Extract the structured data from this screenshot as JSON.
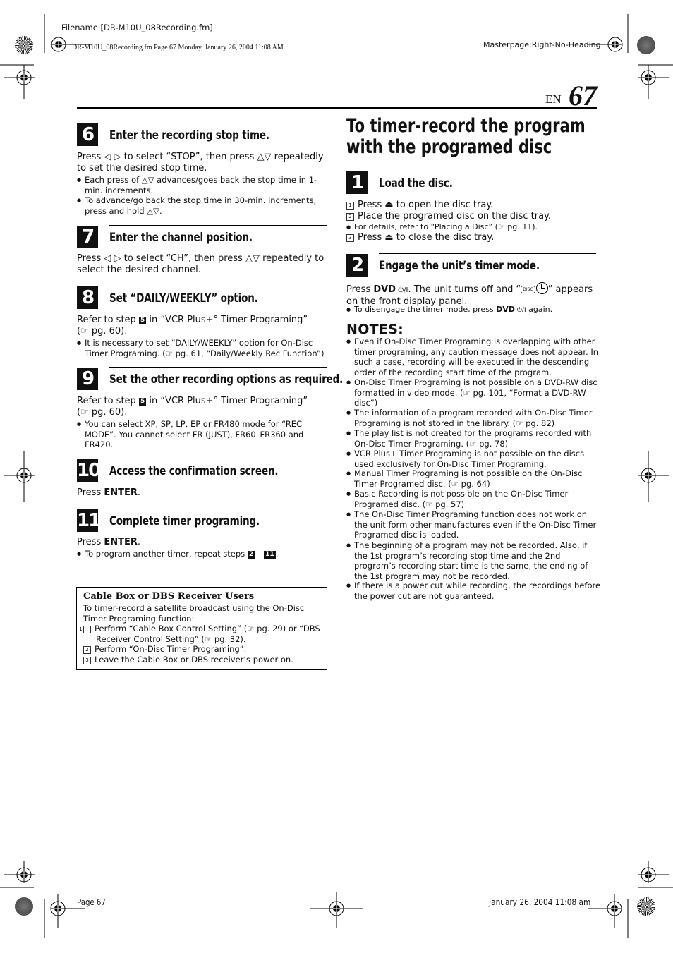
{
  "print_header": {
    "filename": "Filename [DR-M10U_08Recording.fm]",
    "file_line": "DR-M10U_08Recording.fm  Page 67  Monday, January 26, 2004  11:08 AM",
    "masterpage": "Masterpage:Right-No-Heading"
  },
  "page_header": {
    "lang": "EN",
    "page_number": "67"
  },
  "left_column": {
    "steps": [
      {
        "number": "6",
        "title": "Enter the recording stop time.",
        "body": "Press ◁ ▷ to select “STOP”, then press △▽ repeatedly to set the desired stop time.",
        "bullets": [
          "Each press of △▽ advances/goes back the stop time in 1-min. increments.",
          "To advance/go back the stop time in 30-min. increments, press and hold △▽."
        ]
      },
      {
        "number": "7",
        "title": "Enter the channel position.",
        "body": "Press ◁ ▷ to select “CH”, then press △▽ repeatedly to select the desired channel."
      },
      {
        "number": "8",
        "title": "Set “DAILY/WEEKLY” option.",
        "body_pre": "Refer to step ",
        "body_step": "5",
        "body_post": " in “VCR Plus+° Timer Programing” (☞ pg. 60).",
        "bullets": [
          "It is necessary to set “DAILY/WEEKLY” option for On-Disc Timer Programing. (☞ pg. 61, “Daily/Weekly Rec Function”)"
        ]
      },
      {
        "number": "9",
        "title": "Set the other recording options as required.",
        "body_pre": "Refer to step ",
        "body_step": "5",
        "body_post": " in “VCR Plus+° Timer Programing” (☞ pg. 60).",
        "bullets": [
          "You can select XP, SP, LP, EP or FR480 mode for “REC MODE”. You cannot select FR (JUST), FR60–FR360 and FR420."
        ]
      },
      {
        "number": "10",
        "title": "Access the confirmation screen.",
        "body_pre": "Press ",
        "body_bold": "ENTER",
        "body_post": "."
      },
      {
        "number": "11",
        "title": "Complete timer programing.",
        "body_pre": "Press ",
        "body_bold": "ENTER",
        "body_post": ".",
        "bullet_pre": "To program another timer, repeat steps ",
        "bullet_from": "2",
        "bullet_mid": " – ",
        "bullet_to": "11",
        "bullet_post": "."
      }
    ],
    "cable_box": {
      "title": "Cable Box or DBS Receiver Users",
      "intro": "To timer-record a satellite broadcast using the On-Disc Timer Programing function:",
      "items": [
        {
          "n": "1",
          "text": "Perform “Cable Box Control Setting” (☞ pg. 29) or “DBS Receiver Control Setting” (☞ pg. 32)."
        },
        {
          "n": "2",
          "text": "Perform “On-Disc Timer Programing”."
        },
        {
          "n": "3",
          "text": "Leave the Cable Box or DBS receiver’s power on."
        }
      ]
    }
  },
  "right_column": {
    "title": "To timer-record the program with the programed disc",
    "steps": [
      {
        "number": "1",
        "title": "Load the disc.",
        "items": [
          {
            "n": "1",
            "pre": "Press ",
            "icon": "⏏",
            "post": " to open the disc tray."
          },
          {
            "n": "2",
            "text": "Place the programed disc on the disc tray."
          },
          {
            "bullet": "For details, refer to “Placing a Disc” (☞ pg. 11)."
          },
          {
            "n": "3",
            "pre": "Press ",
            "icon": "⏏",
            "post": " to close the disc tray."
          }
        ]
      },
      {
        "number": "2",
        "title": "Engage the unit’s timer mode.",
        "body_pre": "Press ",
        "body_bold": "DVD",
        "body_power": " ⏻/I",
        "body_mid": ". The unit turns off and “",
        "disc_label": "DISC",
        "body_post": "” appears on the front display panel.",
        "bullet_pre": "To disengage the timer mode, press ",
        "bullet_bold": "DVD",
        "bullet_power": " ⏻/I",
        "bullet_post": " again."
      }
    ],
    "notes_title": "NOTES:",
    "notes": [
      "Even if On-Disc Timer Programing is overlapping with other timer programing, any caution message does not appear. In such a case, recording will be executed in the descending order of the recording start time of the program.",
      "On-Disc Timer Programing is not possible on a DVD-RW disc formatted in video mode. (☞ pg. 101, “Format a DVD-RW disc”)",
      "The information of a program recorded with On-Disc Timer Programing is not stored in the library. (☞ pg. 82)",
      "The play list is not created for the programs recorded with On-Disc Timer Programing. (☞ pg. 78)",
      "VCR Plus+ Timer Programing is not possible on the discs used exclusively for On-Disc Timer Programing.",
      "Manual Timer Programing is not possible on the On-Disc Timer Programed disc. (☞ pg. 64)",
      "Basic Recording is not possible on the On-Disc Timer Programed disc. (☞ pg. 57)",
      "The On-Disc Timer Programing function does not work on the unit form other manufactures even if the On-Disc Timer Programed disc is loaded.",
      "The beginning of a program may not be recorded. Also, if the 1st program’s recording stop time and the 2nd program’s recording start time is the same, the ending of the 1st program may not be recorded.",
      "If there is a power cut while recording, the recordings before the power cut are not guaranteed."
    ]
  },
  "footer": {
    "page": "Page 67",
    "date": "January 26, 2004 11:08 am"
  }
}
